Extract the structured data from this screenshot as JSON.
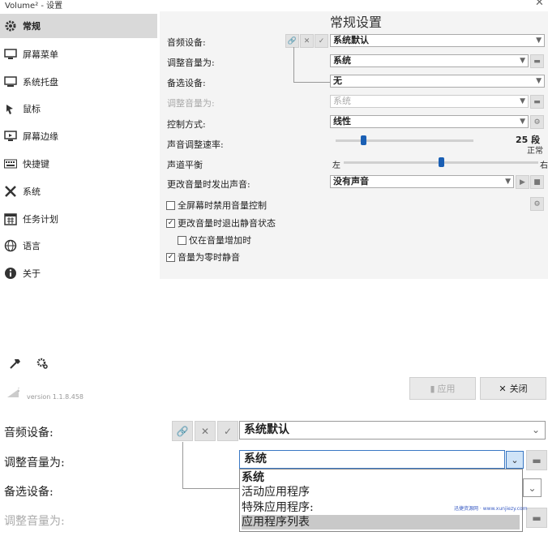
{
  "window": {
    "title": "Volume² - 设置",
    "close_glyph": "✕"
  },
  "sidebar": {
    "items": [
      {
        "label": "常规",
        "icon": "gear-icon"
      },
      {
        "label": "屏幕菜单",
        "icon": "screen-menu-icon"
      },
      {
        "label": "系统托盘",
        "icon": "tray-icon"
      },
      {
        "label": "鼠标",
        "icon": "mouse-icon"
      },
      {
        "label": "屏幕边缘",
        "icon": "screen-edge-icon"
      },
      {
        "label": "快捷键",
        "icon": "keyboard-icon"
      },
      {
        "label": "系统",
        "icon": "tools-icon"
      },
      {
        "label": "任务计划",
        "icon": "calendar-icon"
      },
      {
        "label": "语言",
        "icon": "globe-icon"
      },
      {
        "label": "关于",
        "icon": "info-icon"
      }
    ]
  },
  "main": {
    "title": "常规设置",
    "audio_device": {
      "label": "音频设备:",
      "value": "系统默认"
    },
    "adjust_volume": {
      "label": "调整音量为:",
      "value": "系统"
    },
    "backup_device": {
      "label": "备选设备:",
      "value": "无"
    },
    "adjust_volume2": {
      "label": "调整音量为:",
      "value": "系统"
    },
    "control_mode": {
      "label": "控制方式:",
      "value": "线性"
    },
    "adjust_speed": {
      "label": "声音调整速率:",
      "value": "25 段",
      "sub": "正常",
      "level": 0.2
    },
    "balance": {
      "label": "声道平衡",
      "left": "左",
      "right": "右",
      "level": 0.5
    },
    "sound_on_change": {
      "label": "更改音量时发出声音:",
      "value": "没有声音"
    },
    "checkboxes": [
      {
        "label": "全屏幕时禁用音量控制",
        "checked": false
      },
      {
        "label": "更改音量时退出静音状态",
        "checked": true
      },
      {
        "label": "仅在音量增加时",
        "checked": false
      },
      {
        "label": "音量为零时静音",
        "checked": true
      }
    ]
  },
  "footer": {
    "version": "version 1.1.8.458",
    "apply_label": "应用",
    "close_label": "关闭"
  },
  "zoom": {
    "audio_device_label": "音频设备:",
    "audio_device_value": "系统默认",
    "adjust_label": "调整音量为:",
    "adjust_value": "系统",
    "backup_label": "备选设备:",
    "adjust2_label": "调整音量为:",
    "dropdown_options": [
      "系统",
      "活动应用程序",
      "特殊应用程序:",
      "应用程序列表"
    ],
    "selected_index": 3
  },
  "watermark": "迅捷资源网 · www.xunjiezy.com"
}
